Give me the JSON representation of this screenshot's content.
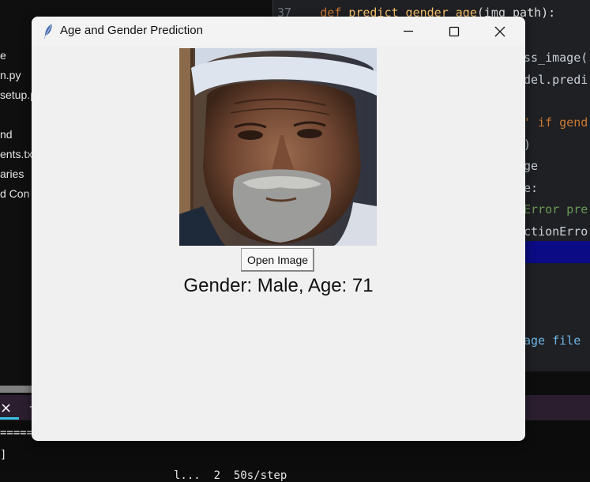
{
  "background": {
    "explorer_items": [
      "e",
      "n.py",
      "setup.p",
      "nd",
      "ents.tx",
      "aries",
      "d Con"
    ],
    "editor_top": {
      "line_number": "37",
      "keyword": "def",
      "function_name": "predict_gender_age",
      "args": "(img_path):"
    },
    "editor_lines": [
      "ss_image(",
      "del.predi",
      "' if gend",
      ")",
      "ge",
      "e:",
      "Error pre",
      "ctionErro",
      "age file"
    ],
    "console_lines": [
      "=====",
      "]",
      "l...  2  50s/step"
    ],
    "colors": {
      "editor_bg": "#1f2024",
      "explorer_bg": "#0f0f10",
      "highlight": "#0b0b86",
      "tab_accent": "#35c3e0"
    }
  },
  "window": {
    "title": "Age and Gender Prediction",
    "open_button_label": "Open Image",
    "result_text": "Gender: Male, Age: 71",
    "photo_subject": "portrait of elderly man with white cap and gray beard"
  }
}
